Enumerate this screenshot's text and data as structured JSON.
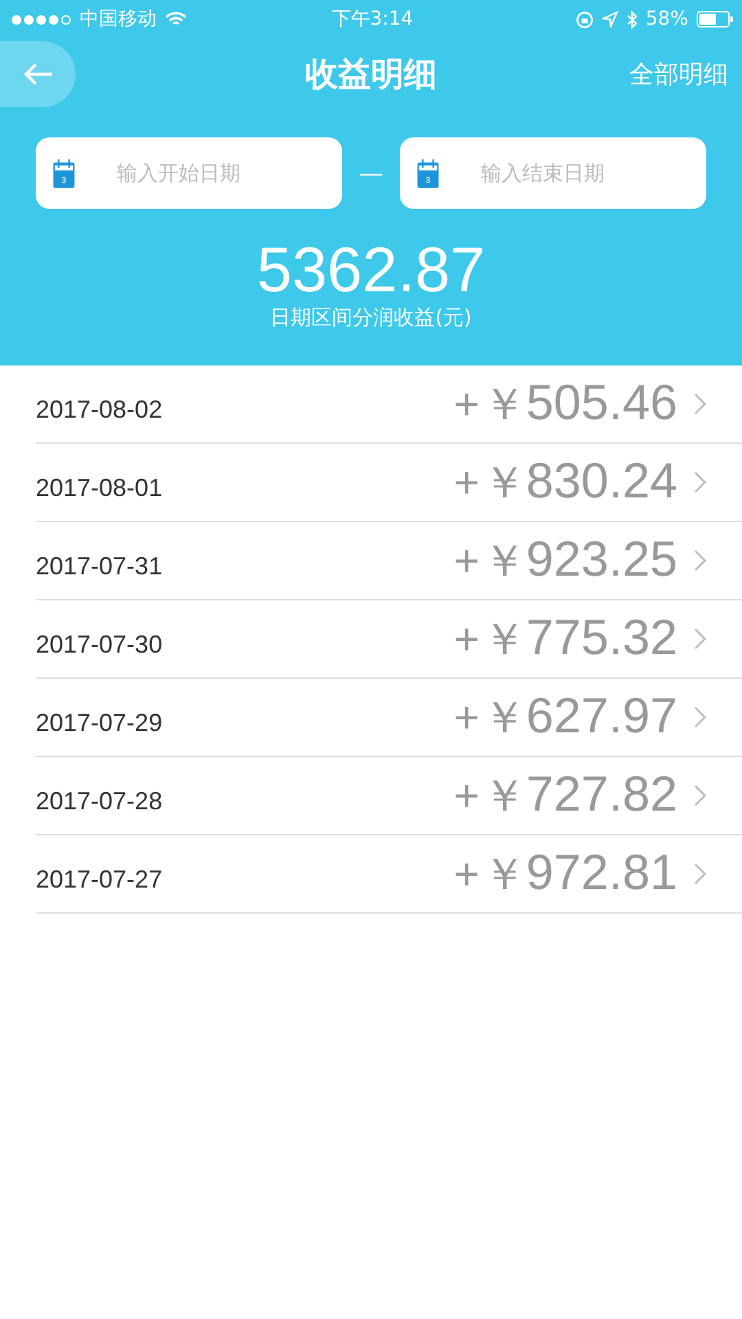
{
  "status_bar": {
    "carrier": "中国移动",
    "time": "下午3:14",
    "battery": "58%"
  },
  "nav": {
    "title": "收益明细",
    "action": "全部明细"
  },
  "date_range": {
    "start": {
      "placeholder": "输入开始日期",
      "calendar_day": "3"
    },
    "separator": "—",
    "end": {
      "placeholder": "输入结束日期",
      "calendar_day": "3"
    }
  },
  "summary": {
    "total": "5362.87",
    "caption": "日期区间分润收益(元)"
  },
  "records": [
    {
      "date": "2017-08-02",
      "sign": "+",
      "currency": "￥",
      "amount": "505.46"
    },
    {
      "date": "2017-08-01",
      "sign": "+",
      "currency": "￥",
      "amount": "830.24"
    },
    {
      "date": "2017-07-31",
      "sign": "+",
      "currency": "￥",
      "amount": "923.25"
    },
    {
      "date": "2017-07-30",
      "sign": "+",
      "currency": "￥",
      "amount": "775.32"
    },
    {
      "date": "2017-07-29",
      "sign": "+",
      "currency": "￥",
      "amount": "627.97"
    },
    {
      "date": "2017-07-28",
      "sign": "+",
      "currency": "￥",
      "amount": "727.82"
    },
    {
      "date": "2017-07-27",
      "sign": "+",
      "currency": "￥",
      "amount": "972.81"
    }
  ]
}
